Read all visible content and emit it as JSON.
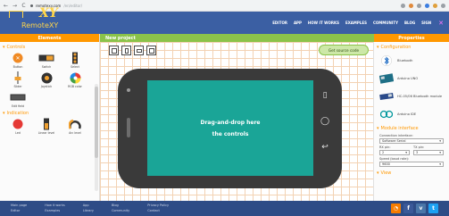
{
  "browser": {
    "url_domain": "remotexy.com",
    "url_path": "/en/editor/",
    "nav_back": "←",
    "nav_forward": "→",
    "nav_reload": "C"
  },
  "header": {
    "logo_top": "XY",
    "logo_bottom": "RemoteXY",
    "nav": [
      "EDITOR",
      "APP",
      "HOW IT WORKS",
      "EXAMPLES",
      "COMMUNITY",
      "BLOG",
      "SIGN"
    ]
  },
  "left_panel": {
    "title": "Elements",
    "sections": [
      {
        "title": "Controls",
        "items": [
          {
            "label": "Button",
            "icon": "button-icon"
          },
          {
            "label": "Switch",
            "icon": "switch-icon"
          },
          {
            "label": "Select",
            "icon": "select-icon"
          },
          {
            "label": "Slider",
            "icon": "slider-icon"
          },
          {
            "label": "Joystick",
            "icon": "joystick-icon"
          },
          {
            "label": "RGB color",
            "icon": "rgb-color-icon"
          },
          {
            "label": "Edit field",
            "icon": "edit-field-icon"
          }
        ]
      },
      {
        "title": "Indication",
        "items": [
          {
            "label": "Led",
            "icon": "led-icon"
          },
          {
            "label": "Linear level",
            "icon": "linear-level-icon"
          },
          {
            "label": "Arc level",
            "icon": "arc-level-icon"
          }
        ]
      }
    ]
  },
  "center": {
    "project_title": "New project",
    "get_source": "Get source code",
    "canvas_line1": "Drag-and-drop here",
    "canvas_line2": "the controls"
  },
  "right_panel": {
    "title": "Properties",
    "configuration_title": "Configuration",
    "config_items": [
      {
        "label": "Bluetooth"
      },
      {
        "label": "Arduino UNO"
      },
      {
        "label": "HC-05/06 Bluetooth module"
      },
      {
        "label": "Arduino IDE"
      }
    ],
    "module_title": "Module interface",
    "connection_label": "Connection interface:",
    "connection_value": "Software Serial",
    "rx_label": "RX pin:",
    "rx_value": "2",
    "tx_label": "TX pin:",
    "tx_value": "3",
    "speed_label": "Speed (baud rate):",
    "speed_value": "9600",
    "view_title": "View"
  },
  "footer": {
    "columns": [
      [
        "Main page",
        "Editor"
      ],
      [
        "How it works",
        "Examples"
      ],
      [
        "App",
        "Library"
      ],
      [
        "Blog",
        "Community"
      ],
      [
        "Privacy Policy",
        "Contact"
      ]
    ],
    "social": [
      "rss-icon",
      "facebook-icon",
      "vk-icon",
      "twitter-icon"
    ]
  },
  "colors": {
    "header_blue": "#3b5fa3",
    "accent_orange": "#ff9800",
    "accent_green": "#8bc34a",
    "screen_teal": "#1aa597",
    "footer_blue": "#2e4c86"
  }
}
